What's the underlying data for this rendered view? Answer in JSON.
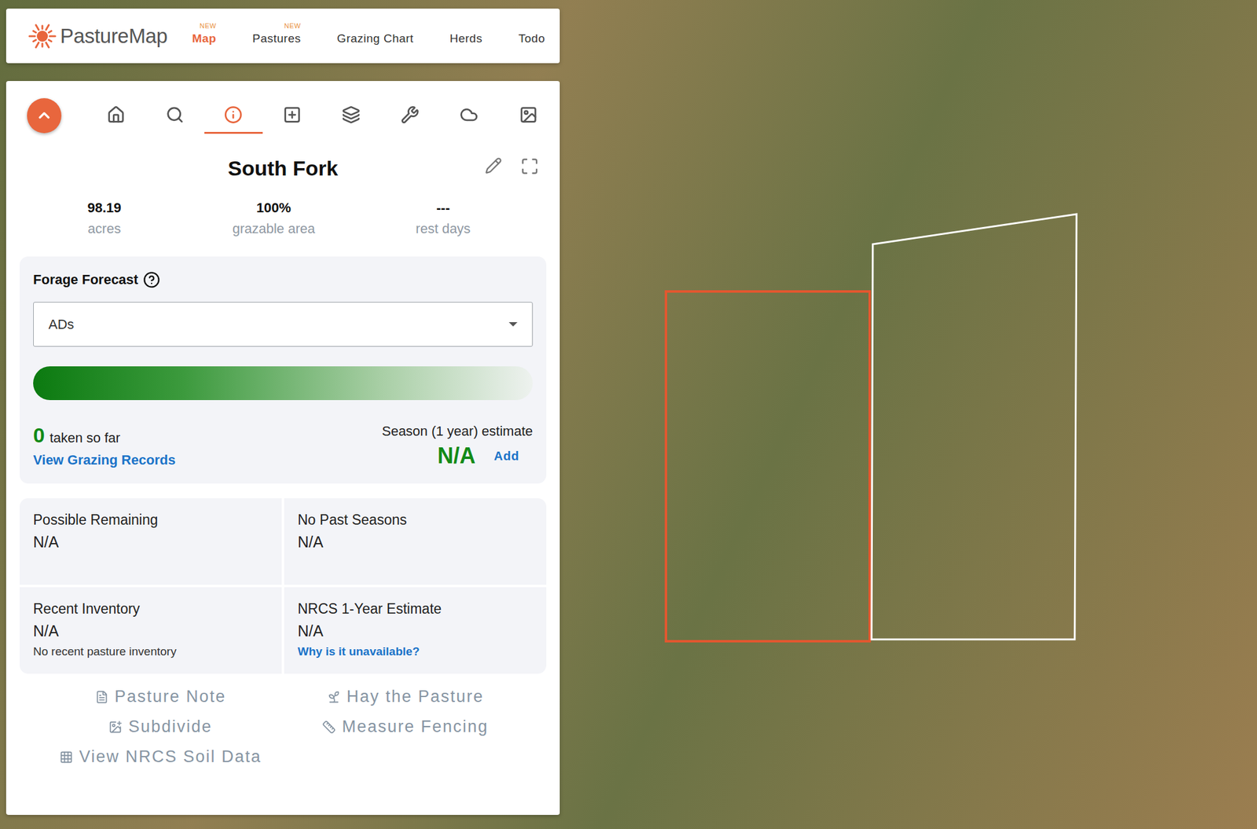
{
  "header": {
    "logo": "PastureMap",
    "nav": [
      {
        "label": "Map",
        "badge": "NEW",
        "selected": true
      },
      {
        "label": "Pastures",
        "badge": "NEW",
        "selected": false
      },
      {
        "label": "Grazing Chart",
        "badge": "",
        "selected": false
      },
      {
        "label": "Herds",
        "badge": "",
        "selected": false
      },
      {
        "label": "Todo",
        "badge": "",
        "selected": false
      }
    ]
  },
  "toolbar": [
    {
      "selected": false
    },
    {
      "selected": false
    },
    {
      "selected": true
    },
    {
      "selected": false
    },
    {
      "selected": false
    },
    {
      "selected": false
    },
    {
      "selected": false
    },
    {
      "selected": false
    }
  ],
  "pasture": {
    "title": "South Fork",
    "stats": [
      {
        "value": "98.19",
        "label": "acres"
      },
      {
        "value": "100%",
        "label": "grazable area"
      },
      {
        "value": "---",
        "label": "rest days"
      }
    ]
  },
  "forecast": {
    "title": "Forage Forecast",
    "unit": "ADs",
    "taken": "0",
    "taken_label": "taken so far",
    "records_link": "View Grazing Records",
    "season_label": "Season (1 year) estimate",
    "season_value": "N/A",
    "add_link": "Add"
  },
  "cards": [
    {
      "label": "Possible Remaining",
      "value": "N/A",
      "note": "",
      "link": ""
    },
    {
      "label": "No Past Seasons",
      "value": "N/A",
      "note": "",
      "link": ""
    },
    {
      "label": "Recent Inventory",
      "value": "N/A",
      "note": "No recent pasture inventory",
      "link": ""
    },
    {
      "label": "NRCS 1-Year Estimate",
      "value": "N/A",
      "note": "",
      "link": "Why is it unavailable?"
    }
  ],
  "actions": [
    "Pasture Note",
    "Hay the Pasture",
    "Subdivide",
    "Measure Fencing",
    "View NRCS Soil Data"
  ],
  "map": {
    "pastures": [
      {
        "selected": true
      },
      {
        "selected": false
      }
    ]
  }
}
